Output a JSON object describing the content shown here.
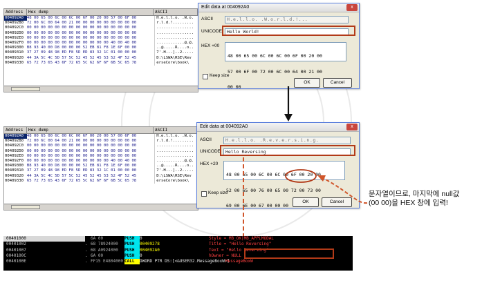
{
  "top_dump": {
    "header": [
      "Address",
      "Hex dump",
      "ASCII"
    ],
    "rows": [
      {
        "addr": "004092A0",
        "hex": "48 00 65 00 6C 00 6C 00 6F 00 20 00 57 00 6F 00",
        "ascii": "H.e.l.l.o. .W.o."
      },
      {
        "addr": "004092B0",
        "hex": "72 00 6C 00 64 00 21 00 00 00 00 00 00 00 00 00",
        "ascii": "r.l.d.!........."
      },
      {
        "addr": "004092C0",
        "hex": "00 00 00 00 00 00 00 00 00 00 00 00 00 00 00 00",
        "ascii": "................"
      },
      {
        "addr": "004092D0",
        "hex": "00 00 00 00 00 00 00 00 00 00 00 00 00 00 00 00",
        "ascii": "................"
      },
      {
        "addr": "004092E0",
        "hex": "00 00 00 00 00 00 00 00 00 00 00 00 00 00 00 00",
        "ascii": "................"
      },
      {
        "addr": "004092F0",
        "hex": "00 00 00 00 00 00 00 00 00 00 00 00 40 00 40 00",
        "ascii": "............@.@."
      },
      {
        "addr": "00409300",
        "hex": "B8 93 40 00 D8 00 00 00 52 EB 81 F8 1E 6F 00 00",
        "ascii": "..@.....R....o.."
      },
      {
        "addr": "00409310",
        "hex": "37 27 09 48 98 ED F8 5D ED 83 32 1C 01 00 00 00",
        "ascii": "7'.H...]..2....."
      },
      {
        "addr": "00409320",
        "hex": "44 3A 5C 4C 5D 57 5C 52 45 52 45 53 52 4F 52 45",
        "ascii": "D:\\LSWA\\RSE\\Rev"
      },
      {
        "addr": "00409330",
        "hex": "65 72 73 65 43 6F 72 65 5C 62 6F 6F 6B 5C 65 78",
        "ascii": "erseCore\\book\\"
      }
    ]
  },
  "top_dialog": {
    "title": "Edit data at 004092A0",
    "ascii_label": "ASCII",
    "ascii_value": "H.e.l.l.o. .W.o.r.l.d.!...",
    "unicode_label": "UNICODE",
    "unicode_value": "Hello World!",
    "hex_label": "HEX +00",
    "hex_lines": [
      "48 00 65 00 6C 00 6C 00 6F 00 20 00",
      "57 00 6F 00 72 00 6C 00 64 00 21 00",
      "00 00"
    ],
    "keep_size": "Keep size",
    "ok": "OK",
    "cancel": "Cancel",
    "close": "x"
  },
  "mid_dump": {
    "header": [
      "Address",
      "Hex dump",
      "ASCII"
    ],
    "rows": [
      {
        "addr": "004092A0",
        "hex": "48 00 65 00 6C 00 6C 00 6F 00 20 00 57 00 6F 00",
        "ascii": "H.e.l.l.o. .W.o."
      },
      {
        "addr": "004092B0",
        "hex": "72 00 6C 00 64 00 21 00 00 00 00 00 00 00 00 00",
        "ascii": "r.l.d.!........."
      },
      {
        "addr": "004092C0",
        "hex": "00 00 00 00 00 00 00 00 00 00 00 00 00 00 00 00",
        "ascii": "................"
      },
      {
        "addr": "004092D0",
        "hex": "00 00 00 00 00 00 00 00 00 00 00 00 00 00 00 00",
        "ascii": "................"
      },
      {
        "addr": "004092E0",
        "hex": "00 00 00 00 00 00 00 00 00 00 00 00 00 00 00 00",
        "ascii": "................"
      },
      {
        "addr": "004092F0",
        "hex": "00 00 00 00 00 00 00 00 00 00 00 00 40 00 40 00",
        "ascii": "............@.@."
      },
      {
        "addr": "00409300",
        "hex": "B8 93 40 00 D8 00 00 00 52 EB 81 F8 1E 6F 00 00",
        "ascii": "..@.....R....o.."
      },
      {
        "addr": "00409310",
        "hex": "37 27 09 48 98 ED F8 5D ED 83 32 1C 01 00 00 00",
        "ascii": "7'.H...]..2....."
      },
      {
        "addr": "00409320",
        "hex": "44 3A 5C 4C 5D 57 5C 52 45 52 45 53 52 4F 52 45",
        "ascii": "D:\\LSWA\\RSE\\Rev"
      },
      {
        "addr": "00409330",
        "hex": "65 72 73 65 43 6F 72 65 5C 62 6F 6F 6B 5C 65 78",
        "ascii": "erseCore\\book\\"
      }
    ]
  },
  "mid_dialog": {
    "title": "Edit data at 004092A0",
    "ascii_label": "ASCII",
    "ascii_value": "H.e.l.l.o. .R.e.v.e.r.s.i.n.g.",
    "unicode_label": "UNICODE",
    "unicode_value": "Hello Reversing",
    "hex_label": "HEX +20",
    "hex_lines": [
      "48 00 65 00 6C 00 6C 00 6F 00 20 00",
      "52 00 65 00 76 00 65 00 72 00 73 00",
      "69 00 6E 00 67 00 00 00"
    ],
    "keep_size": "Keep size",
    "ok": "OK",
    "cancel": "Cancel",
    "close": "x"
  },
  "annotation": {
    "line1": "문자열이므로, 마지막에 null값",
    "line2": "(00 00)을 HEX 창에 입력!"
  },
  "disasm": {
    "rows": [
      {
        "addr": "00401000",
        "bullet": "",
        "hex": "6A 00",
        "mn": "PUSH",
        "op": "0",
        "comment": "Style = MB_OK|MB_APPLMODAL",
        "sel": true,
        "yellow": false,
        "op_white": true
      },
      {
        "addr": "00401002",
        "bullet": ".",
        "hex": "68 78924000",
        "mn": "PUSH",
        "op": "00409278",
        "comment": "Title = \"Hello Reversing\"",
        "sel": false,
        "yellow": false,
        "op_white": false
      },
      {
        "addr": "00401007",
        "bullet": ".",
        "hex": "68 A0924000",
        "mn": "PUSH",
        "op": "004092A0",
        "comment": "Text = \"Hello Reversing\"",
        "sel": false,
        "yellow": false,
        "op_white": false
      },
      {
        "addr": "0040100C",
        "bullet": ".",
        "hex": "6A 00",
        "mn": "PUSH",
        "op": "0",
        "comment": "hOwner = NULL",
        "sel": false,
        "yellow": false,
        "op_white": true
      },
      {
        "addr": "0040100E",
        "bullet": ".",
        "hex": "FF15 E4804000",
        "mn": "CALL",
        "op": "DWORD PTR DS:[<&USER32.MessageBoxW>]",
        "comment": "MessageBoxW",
        "sel": false,
        "yellow": true,
        "op_white": true
      }
    ]
  },
  "colors": {
    "highlight_box": "#b23a18",
    "arrow_black": "#111111",
    "arrow_orange": "#d0552a"
  }
}
